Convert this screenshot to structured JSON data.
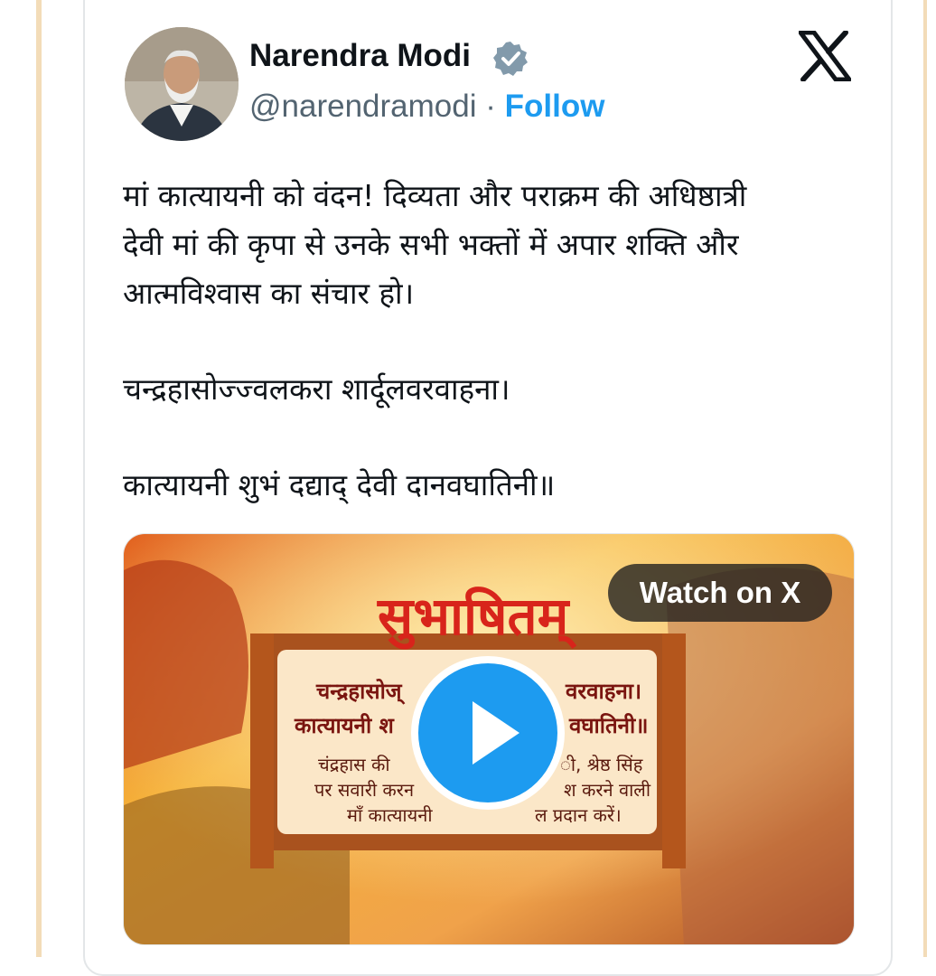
{
  "author": {
    "name": "Narendra Modi",
    "handle": "@narendramodi",
    "separator": " · ",
    "follow_label": "Follow"
  },
  "icons": {
    "verified": "verified-badge-icon",
    "brand": "x-logo-icon",
    "play": "play-icon"
  },
  "tweet": {
    "line1": "मां कात्यायनी को वंदन! दिव्यता और पराक्रम की अधिष्ठात्री",
    "line2": "देवी मां की कृपा से उनके सभी भक्तों में अपार शक्ति और",
    "line3": "आत्मविश्वास का संचार हो।",
    "line4": "चन्द्रहासोज्ज्वलकरा शार्दूलवरवाहना।",
    "line5": "कात्यायनी शुभं दद्याद् देवी दानवघातिनी॥"
  },
  "media": {
    "watch_label": "Watch on X",
    "banner_title": "सुभाषितम्",
    "verse_left_1": "चन्द्रहासोज्",
    "verse_right_1": "वरवाहना।",
    "verse_left_2": "कात्यायनी श",
    "verse_right_2": "वघातिनी॥",
    "meaning_left_1": "चंद्रहास की",
    "meaning_right_1": "ी, श्रेष्ठ सिंह",
    "meaning_left_2": "पर सवारी करन",
    "meaning_right_2": "श करने वाली",
    "meaning_left_3": "माँ कात्यायनी",
    "meaning_right_3": "ल प्रदान करें।"
  },
  "colors": {
    "accent": "#1d9bf0",
    "text": "#0f1419",
    "muted": "#536471",
    "banner_red": "#d8241b"
  }
}
